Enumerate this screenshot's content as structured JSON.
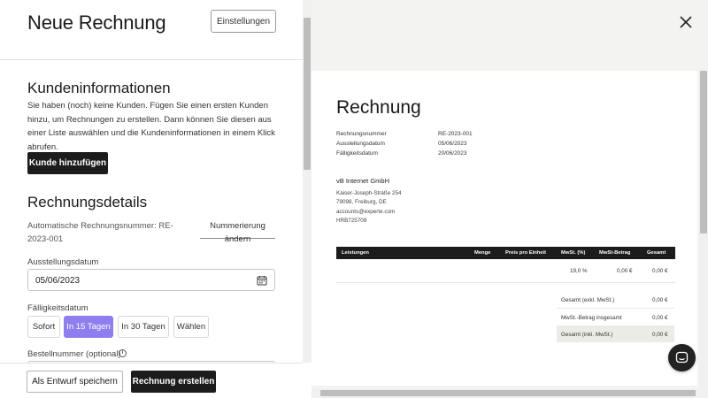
{
  "header": {
    "title": "Neue Rechnung",
    "settings_label": "Einstellungen"
  },
  "customer": {
    "title": "Kundeninformationen",
    "description": "Sie haben (noch) keine Kunden. Fügen Sie einen ersten Kunden hinzu, um Rechnungen zu erstellen. Dann können Sie diesen aus einer Liste auswählen und die Kundeninformationen in einem Klick abrufen.",
    "add_button": "Kunde hinzufügen"
  },
  "details": {
    "title": "Rechnungsdetails",
    "auto_number": "Automatische Rechnungsnummer: RE-2023-001",
    "renumber_label": "Nummerierung ändern",
    "issue_date_label": "Ausstellungsdatum",
    "issue_date_value": "05/06/2023",
    "due_date_label": "Fälligkeitsdatum",
    "due_options": [
      "Sofort",
      "In 15 Tagen",
      "In 30 Tagen",
      "Wählen"
    ],
    "due_selected": "In 15 Tagen",
    "order_number_label": "Bestellnummer (optional)"
  },
  "footer": {
    "draft_button": "Als Entwurf speichern",
    "create_button": "Rechnung erstellen"
  },
  "preview": {
    "title": "Rechnung",
    "meta": [
      {
        "label": "Rechnungsnummer",
        "value": "RE-2023-001"
      },
      {
        "label": "Ausstellungsdatum",
        "value": "05/06/2023"
      },
      {
        "label": "Fälligkeitsdatum",
        "value": "20/06/2023"
      }
    ],
    "company": "vB Internet GmbH",
    "address": [
      "Kaiser-Joseph-Straße 254",
      "79098, Freiburg, DE",
      "accounts@experte.com",
      "HRB725709"
    ],
    "columns": [
      "Leistungen",
      "Menge",
      "Preis pro Einheit",
      "MwSt. (%)",
      "MwSt-Betrag",
      "Gesamt"
    ],
    "row": {
      "vat_percent": "19,0 %",
      "vat_amount": "0,00 €",
      "total": "0,00 €"
    },
    "totals": [
      {
        "label": "Gesamt (exkl. MwSt.)",
        "value": "0,00 €"
      },
      {
        "label": "MwSt.-Betrag insgesamt",
        "value": "0,00 €"
      },
      {
        "label": "Gesamt (inkl. MwSt.)",
        "value": "0,00 €"
      }
    ]
  },
  "colors": {
    "accent": "#8f7ef0",
    "primary_button": "#1c1c1c",
    "preview_bg": "#f3f3f1"
  },
  "icons": [
    "calendar-icon",
    "info-icon",
    "close-icon",
    "chat-icon"
  ]
}
